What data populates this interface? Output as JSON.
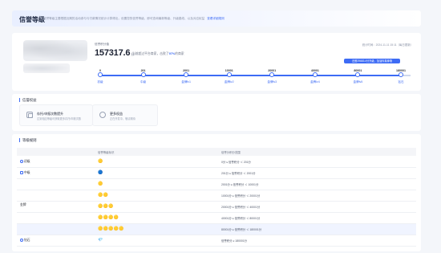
{
  "header": {
    "title": "信誉等级",
    "description": "信誉等级主要根据近期的活动参与与付款情况统计计算得出，设置您的信誉等级，即可查询最新等级、升级路线、以及对应权益",
    "link": "查看详细规则"
  },
  "level": {
    "current_label": "信誉积分值",
    "current_value": "157317.6",
    "current_unit": "分",
    "beat_note_prefix": "当前超过平台商家，击败了",
    "beat_percent": "97%",
    "beat_note_suffix": "的商家",
    "stat_time": "统计时间：2024-11-11 15:11（每日更新）",
    "tooltip": "还差29683.4分升级，加油你真棒哦",
    "progress_fraction": 0.97,
    "ticks": [
      {
        "value": "0",
        "level": "初级"
      },
      {
        "value": "201",
        "level": "中级"
      },
      {
        "value": "2001",
        "level": "金牌lv1"
      },
      {
        "value": "10001",
        "level": "金牌lv2"
      },
      {
        "value": "20001",
        "level": "金牌lv3"
      },
      {
        "value": "40001",
        "level": "金牌lv4"
      },
      {
        "value": "80001",
        "level": "金牌lv5"
      },
      {
        "value": "180001",
        "level": "钻石"
      }
    ]
  },
  "benefits": {
    "title": "信誉权益",
    "items": [
      {
        "name": "存托/申报次数提升",
        "sub": "达到相应等级可获取更多存托/申报次数",
        "icon": "box-icon"
      },
      {
        "name": "更多权益",
        "sub": "正在开发中，敬请期待",
        "icon": "gift-icon"
      }
    ]
  },
  "rules": {
    "title": "等级规则",
    "columns": [
      "",
      "信誉等级标识",
      "信誉分积分范围"
    ],
    "merged_level": "金牌",
    "rows": [
      {
        "level": "初级",
        "badge": "🟡",
        "rule": "0分 ≤ 信誉积分 ＜ 201分"
      },
      {
        "level": "中级",
        "badge": "🔵",
        "rule": "201分 ≤ 信誉积分 ＜ 2001分"
      },
      {
        "level": "",
        "badge": "🟡",
        "rule": "2001分 ≤ 信誉积分 ＜ 10001分"
      },
      {
        "level": "",
        "badge": "🟡🟡",
        "rule": "10001分 ≤ 信誉积分 ＜ 20001分"
      },
      {
        "level": "",
        "badge": "🟡🟡🟡",
        "rule": "20001分 ≤ 信誉积分 ＜ 40001分"
      },
      {
        "level": "",
        "badge": "🟡🟡🟡🟡",
        "rule": "40001分 ≤ 信誉积分 ＜ 80001分"
      },
      {
        "level": "",
        "badge": "🟡🟡🟡🟡🟡",
        "rule": "80001分 ≤ 信誉积分 ＜ 180001分"
      },
      {
        "level": "钻石",
        "badge": "💎",
        "rule": "信誉积分 ≥ 180001分"
      }
    ]
  },
  "colors": {
    "accent": "#3d6bf5",
    "gold": "#f2b84b",
    "diamond": "#e0506b"
  }
}
